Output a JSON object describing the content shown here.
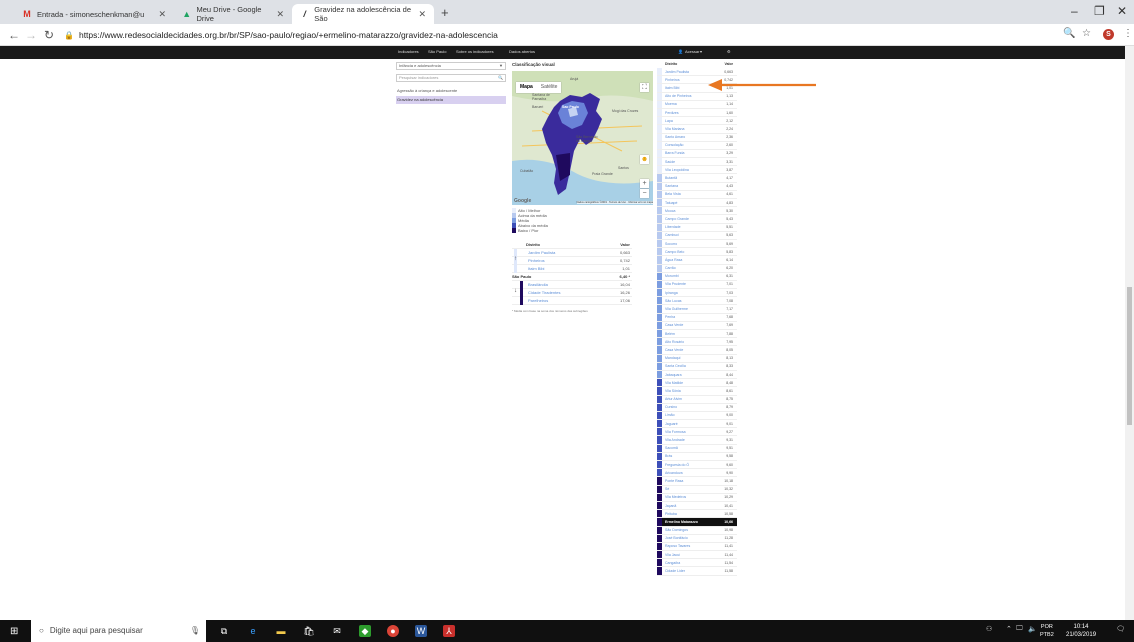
{
  "browser": {
    "tabs": [
      {
        "title": "Entrada - simoneschenkman@u",
        "icon": "gmail-icon"
      },
      {
        "title": "Meu Drive - Google Drive",
        "icon": "drive-icon"
      },
      {
        "title": "Gravidez na adolescência de São",
        "icon": "site-icon"
      }
    ],
    "url": "https://www.redesocialdecidades.org.br/br/SP/sao-paulo/regiao/+ermelino-matarazzo/gravidez-na-adolescencia"
  },
  "sitenav": {
    "items": [
      "Indicadores",
      "São Paulo",
      "Sobre os indicadores",
      "Dados abertos"
    ],
    "user": "Acessar",
    "user_caret": "▾"
  },
  "left": {
    "select_value": "Infância e adolescência",
    "search_placeholder": "Pesquisar indicadores",
    "menu": [
      "Agressão à criança e adolescente",
      "Gravidez na adolescência"
    ]
  },
  "center": {
    "title": "Classificação visual",
    "map_toggle": [
      "Mapa",
      "Satélite"
    ],
    "map_labels": [
      "Arujá",
      "Sao Paulo",
      "Barueri",
      "Mogi das Cruzes",
      "Santana de Parnaíba",
      "São Bernardo do Campo",
      "Santos",
      "Praia Grande",
      "Cubatão"
    ],
    "google": "Google",
    "attribution": "Dados cartográficos ©2019 · Termos de Uso · Informar erro no mapa",
    "legend": [
      {
        "label": "Alto / Melhor",
        "color": "#e8eefb"
      },
      {
        "label": "Acima da média",
        "color": "#b7c9ef"
      },
      {
        "label": "Média",
        "color": "#7c9de0"
      },
      {
        "label": "Abaixo da média",
        "color": "#3d4fb8"
      },
      {
        "label": "Baixo / Pior",
        "color": "#1f0a5e"
      }
    ],
    "table": {
      "head": [
        "Distrito",
        "Valor"
      ],
      "top": [
        {
          "name": "Jardim Paulista",
          "value": "0,663"
        },
        {
          "name": "Pinheiros",
          "value": "0,742"
        },
        {
          "name": "Itaim Bibi",
          "value": "1,01"
        }
      ],
      "city": {
        "name": "São Paulo",
        "value": "6,40 *"
      },
      "bottom": [
        {
          "name": "Brasilândia",
          "value": "16,04"
        },
        {
          "name": "Cidade Tiradentes",
          "value": "16,26"
        },
        {
          "name": "Parelheiros",
          "value": "17,06"
        }
      ],
      "note": "* Média com base na soma dos números das subregiões"
    }
  },
  "ranking": {
    "head": [
      "Distrito",
      "Valor"
    ],
    "rows": [
      {
        "name": "Jardim Paulista",
        "value": "0,663"
      },
      {
        "name": "Pinheiros",
        "value": "0,742"
      },
      {
        "name": "Itaim Bibi",
        "value": "1,01"
      },
      {
        "name": "Alto de Pinheiros",
        "value": "1,13"
      },
      {
        "name": "Moema",
        "value": "1,14"
      },
      {
        "name": "Perdizes",
        "value": "1,60"
      },
      {
        "name": "Lapa",
        "value": "2,12"
      },
      {
        "name": "Vila Mariana",
        "value": "2,24"
      },
      {
        "name": "Santo Amaro",
        "value": "2,36"
      },
      {
        "name": "Consolação",
        "value": "2,60"
      },
      {
        "name": "Barra Funda",
        "value": "3,29"
      },
      {
        "name": "Saúde",
        "value": "3,31"
      },
      {
        "name": "Vila Leopoldina",
        "value": "3,87"
      },
      {
        "name": "Butantã",
        "value": "4,17"
      },
      {
        "name": "Santana",
        "value": "4,43"
      },
      {
        "name": "Bela Vista",
        "value": "4,61"
      },
      {
        "name": "Tatuapé",
        "value": "4,83"
      },
      {
        "name": "Mooca",
        "value": "5,30"
      },
      {
        "name": "Campo Grande",
        "value": "5,43"
      },
      {
        "name": "Liberdade",
        "value": "5,51"
      },
      {
        "name": "Cambuci",
        "value": "5,63"
      },
      {
        "name": "Socorro",
        "value": "5,69"
      },
      {
        "name": "Campo Belo",
        "value": "5,83"
      },
      {
        "name": "Água Rasa",
        "value": "6,14"
      },
      {
        "name": "Carrão",
        "value": "6,20"
      },
      {
        "name": "Morumbi",
        "value": "6,31"
      },
      {
        "name": "Vila Prudente",
        "value": "7,01"
      },
      {
        "name": "Ipiranga",
        "value": "7,03"
      },
      {
        "name": "São Lucas",
        "value": "7,08"
      },
      {
        "name": "Vila Guilherme",
        "value": "7,17"
      },
      {
        "name": "Penha",
        "value": "7,68"
      },
      {
        "name": "Casa Verde",
        "value": "7,69"
      },
      {
        "name": "Belém",
        "value": "7,88"
      },
      {
        "name": "Alto Rosário",
        "value": "7,95"
      },
      {
        "name": "Casa Verde",
        "value": "8,05"
      },
      {
        "name": "Mandaqui",
        "value": "8,13"
      },
      {
        "name": "Santa Cecília",
        "value": "8,33"
      },
      {
        "name": "Jabaquara",
        "value": "8,44"
      },
      {
        "name": "Vila Matilde",
        "value": "8,48"
      },
      {
        "name": "Vila Sônia",
        "value": "8,61"
      },
      {
        "name": "Artur Alvim",
        "value": "8,75"
      },
      {
        "name": "Cursino",
        "value": "8,79"
      },
      {
        "name": "Limão",
        "value": "9,00"
      },
      {
        "name": "Jaguaré",
        "value": "9,01"
      },
      {
        "name": "Vila Formosa",
        "value": "9,27"
      },
      {
        "name": "Vila Andrade",
        "value": "9,31"
      },
      {
        "name": "Sacomã",
        "value": "9,51"
      },
      {
        "name": "Brás",
        "value": "9,58"
      },
      {
        "name": "Freguesia do Ó",
        "value": "9,60"
      },
      {
        "name": "Aricanduva",
        "value": "9,90"
      },
      {
        "name": "Ponte Rasa",
        "value": "10,18"
      },
      {
        "name": "Sé",
        "value": "10,32"
      },
      {
        "name": "Vila Medeiros",
        "value": "10,29"
      },
      {
        "name": "Jaçanã",
        "value": "10,41"
      },
      {
        "name": "Pirituba",
        "value": "10,58"
      },
      {
        "name": "Ermelino Matarazzo",
        "value": "10,66",
        "highlight": true
      },
      {
        "name": "São Domingos",
        "value": "10,98"
      },
      {
        "name": "José Bonifácio",
        "value": "11,28"
      },
      {
        "name": "Raposo Tavares",
        "value": "11,41"
      },
      {
        "name": "Vila Jacuí",
        "value": "11,44"
      },
      {
        "name": "Cangaíba",
        "value": "11,54"
      },
      {
        "name": "Cidade Líder",
        "value": "11,58"
      }
    ]
  },
  "taskbar": {
    "search_placeholder": "Digite aqui para pesquisar",
    "lang": [
      "POR",
      "PTB2"
    ],
    "time": "10:14",
    "date": "21/03/2019"
  },
  "colors": {
    "arrow": "#e87722",
    "highlight_row": "#111111",
    "menu_active": "#d8d0f0"
  }
}
